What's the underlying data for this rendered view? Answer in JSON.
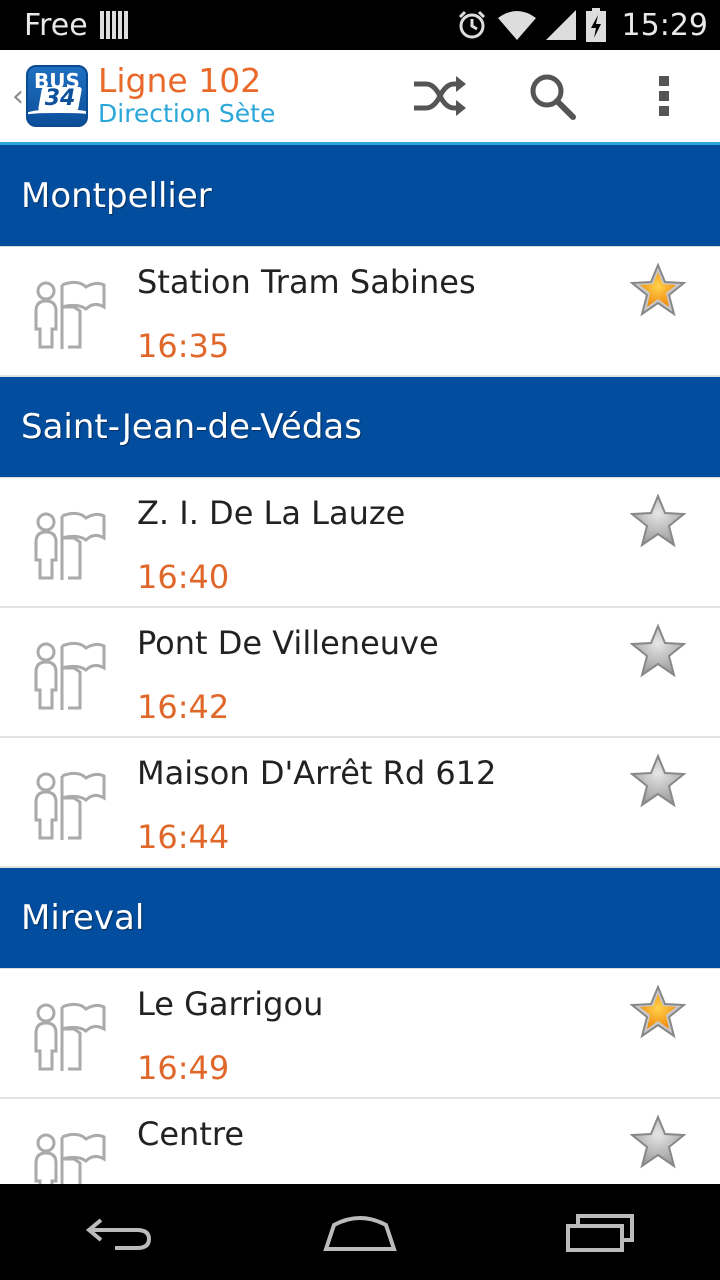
{
  "status_bar": {
    "carrier": "Free",
    "time": "15:29",
    "icons": [
      "sim-icon",
      "alarm-icon",
      "wifi-icon",
      "signal-icon",
      "battery-charging-icon"
    ]
  },
  "action_bar": {
    "title": "Ligne 102",
    "subtitle": "Direction Sète",
    "logo_top": "BUS",
    "logo_num": "34",
    "actions": [
      "shuffle-icon",
      "search-icon",
      "overflow-menu-icon"
    ]
  },
  "colors": {
    "header_blue": "#034d9e",
    "accent_orange": "#e0672a",
    "accent_cyan": "#2aa7d8",
    "star_gold": "#f5a623"
  },
  "sections": [
    {
      "name": "Montpellier",
      "stops": [
        {
          "name": "Station Tram Sabines",
          "time": "16:35",
          "favorite": true
        }
      ]
    },
    {
      "name": "Saint-Jean-de-Védas",
      "stops": [
        {
          "name": "Z. I. De La Lauze",
          "time": "16:40",
          "favorite": false
        },
        {
          "name": "Pont De Villeneuve",
          "time": "16:42",
          "favorite": false
        },
        {
          "name": "Maison D'Arrêt Rd 612",
          "time": "16:44",
          "favorite": false
        }
      ]
    },
    {
      "name": "Mireval",
      "stops": [
        {
          "name": "Le Garrigou",
          "time": "16:49",
          "favorite": true
        },
        {
          "name": "Centre",
          "time": "",
          "favorite": false
        }
      ]
    }
  ],
  "nav_bar": [
    "back-icon",
    "home-icon",
    "recent-apps-icon"
  ]
}
